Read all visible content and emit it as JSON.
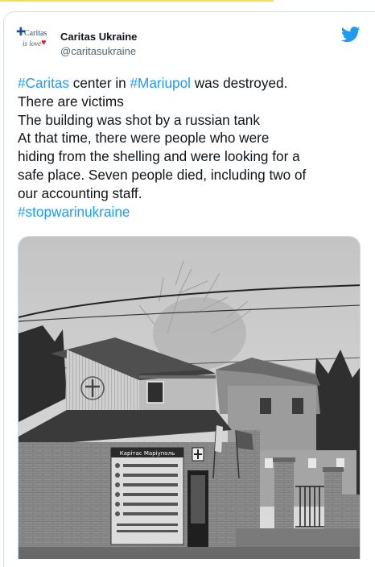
{
  "author": {
    "name": "Caritas Ukraine",
    "handle": "@caritasukraine",
    "avatar": {
      "logo_word": "Caritas",
      "logo_tagline": "is love",
      "logo_heart": "♥"
    }
  },
  "tweet": {
    "line1": {
      "tag_caritas": "#Caritas",
      "mid": " center in ",
      "tag_mariupol": "#Mariupol",
      "tail": " was destroyed."
    },
    "line2": "There are victims",
    "line3": "The building was shot by a russian tank",
    "line4": "At that time, there were people who were",
    "line5": "hiding from the shelling and were looking for a",
    "line6": "safe place. Seven people died, including two of",
    "line7": "our accounting staff.",
    "line8_tag": "#stopwarinukraine"
  },
  "photo": {
    "sign_title": "Карітас Маріуполь"
  },
  "colors": {
    "link": "#1d9bf0",
    "twitter_blue": "#1d9bf0",
    "text": "#0f1419",
    "secondary_text": "#536471",
    "border": "#cfd9de"
  },
  "icons": {
    "platform": "twitter-bird-icon"
  }
}
